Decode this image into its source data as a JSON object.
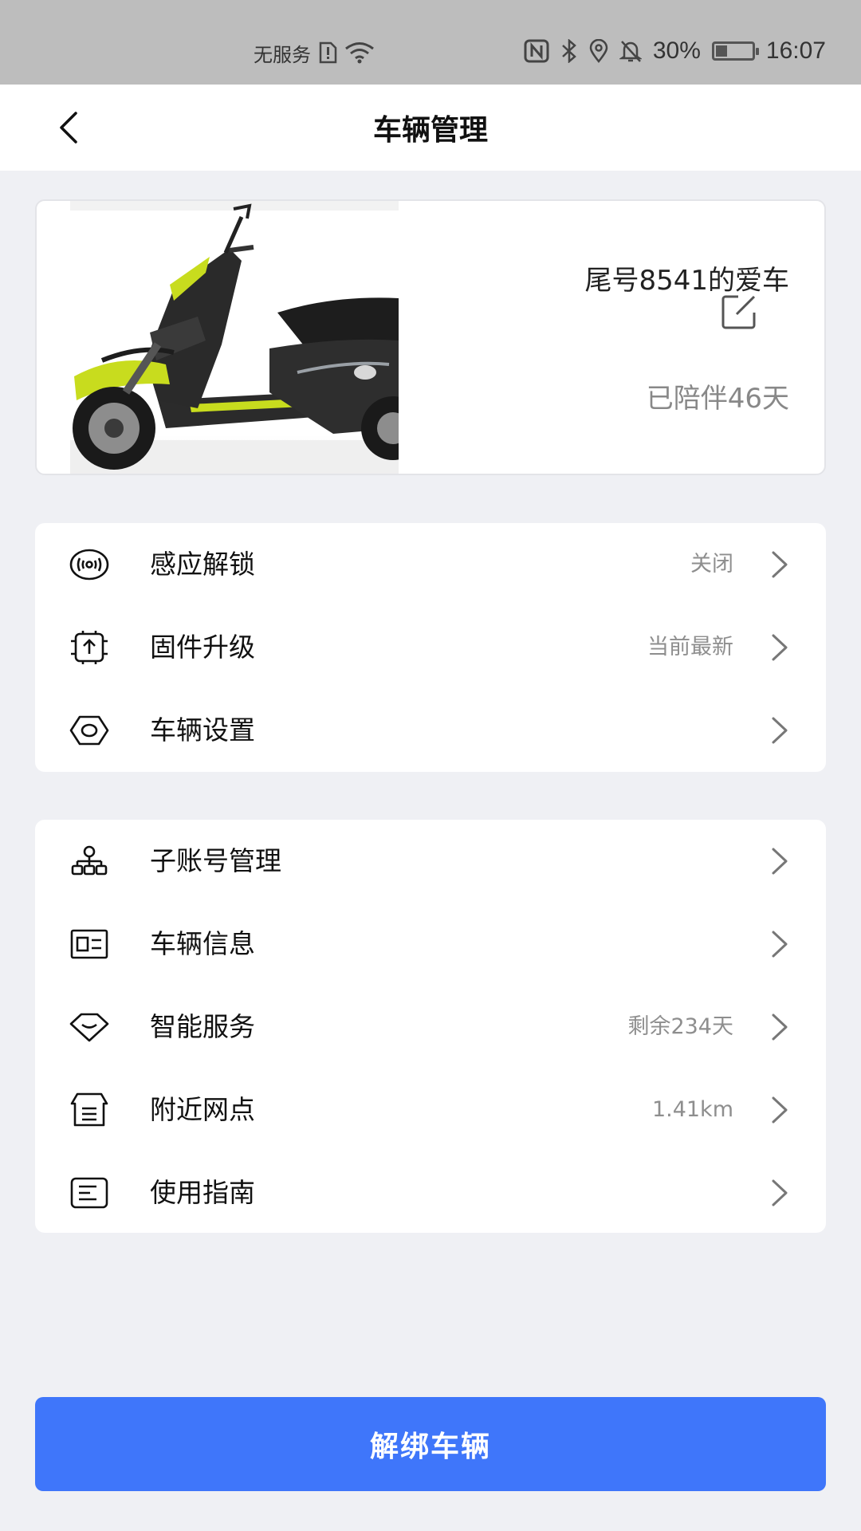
{
  "status_bar": {
    "carrier": "无服务",
    "battery_percent": "30%",
    "time": "16:07",
    "icons": [
      "sim-alert-icon",
      "wifi-icon",
      "nfc-icon",
      "bluetooth-icon",
      "location-icon",
      "mute-bell-icon",
      "battery-charging-icon"
    ]
  },
  "header": {
    "title": "车辆管理",
    "back_icon": "chevron-left-icon"
  },
  "vehicle": {
    "name": "尾号8541的爱车",
    "days": "已陪伴46天",
    "edit_icon": "edit-icon",
    "photo_alt": "scooter-photo"
  },
  "menu_groups": [
    {
      "items": [
        {
          "label": "感应解锁",
          "value": "关闭",
          "icon": "proximity-icon"
        },
        {
          "label": "固件升级",
          "value": "当前最新",
          "icon": "firmware-chip-icon"
        },
        {
          "label": "车辆设置",
          "value": "",
          "icon": "hex-nut-icon"
        }
      ]
    },
    {
      "items": [
        {
          "label": "子账号管理",
          "value": "",
          "icon": "org-tree-icon"
        },
        {
          "label": "车辆信息",
          "value": "",
          "icon": "id-card-icon"
        },
        {
          "label": "智能服务",
          "value": "剩余234天",
          "icon": "diamond-icon"
        },
        {
          "label": "附近网点",
          "value": "1.41km",
          "icon": "store-icon"
        },
        {
          "label": "使用指南",
          "value": "",
          "icon": "guide-doc-icon"
        }
      ]
    }
  ],
  "unbind_button": {
    "label": "解绑车辆"
  },
  "colors": {
    "accent": "#3f76fa",
    "background": "#eff0f4",
    "scooter_accent": "#c8dc1e"
  }
}
